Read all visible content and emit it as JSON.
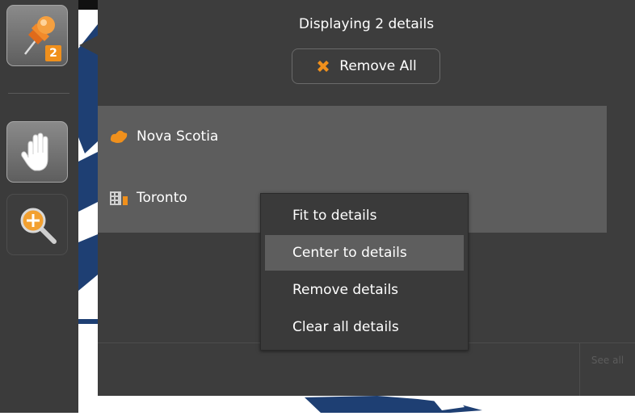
{
  "toolbar": {
    "details_count_badge": "2"
  },
  "panel": {
    "title": "Displaying 2 details",
    "remove_all_label": "Remove All",
    "items": [
      {
        "label": "Nova Scotia",
        "icon": "region-shape-icon"
      },
      {
        "label": "Toronto",
        "icon": "building-chart-icon"
      }
    ],
    "see_all_label": "See all"
  },
  "context_menu": {
    "items": [
      {
        "label": "Fit to details"
      },
      {
        "label": "Center to details",
        "highlighted": true
      },
      {
        "label": "Remove details"
      },
      {
        "label": "Clear all details"
      }
    ]
  },
  "colors": {
    "panel_bg": "#3d3d3d",
    "list_bg": "#5d5d5d",
    "accent_orange": "#f0901c",
    "map_water": "#1e3f73"
  }
}
